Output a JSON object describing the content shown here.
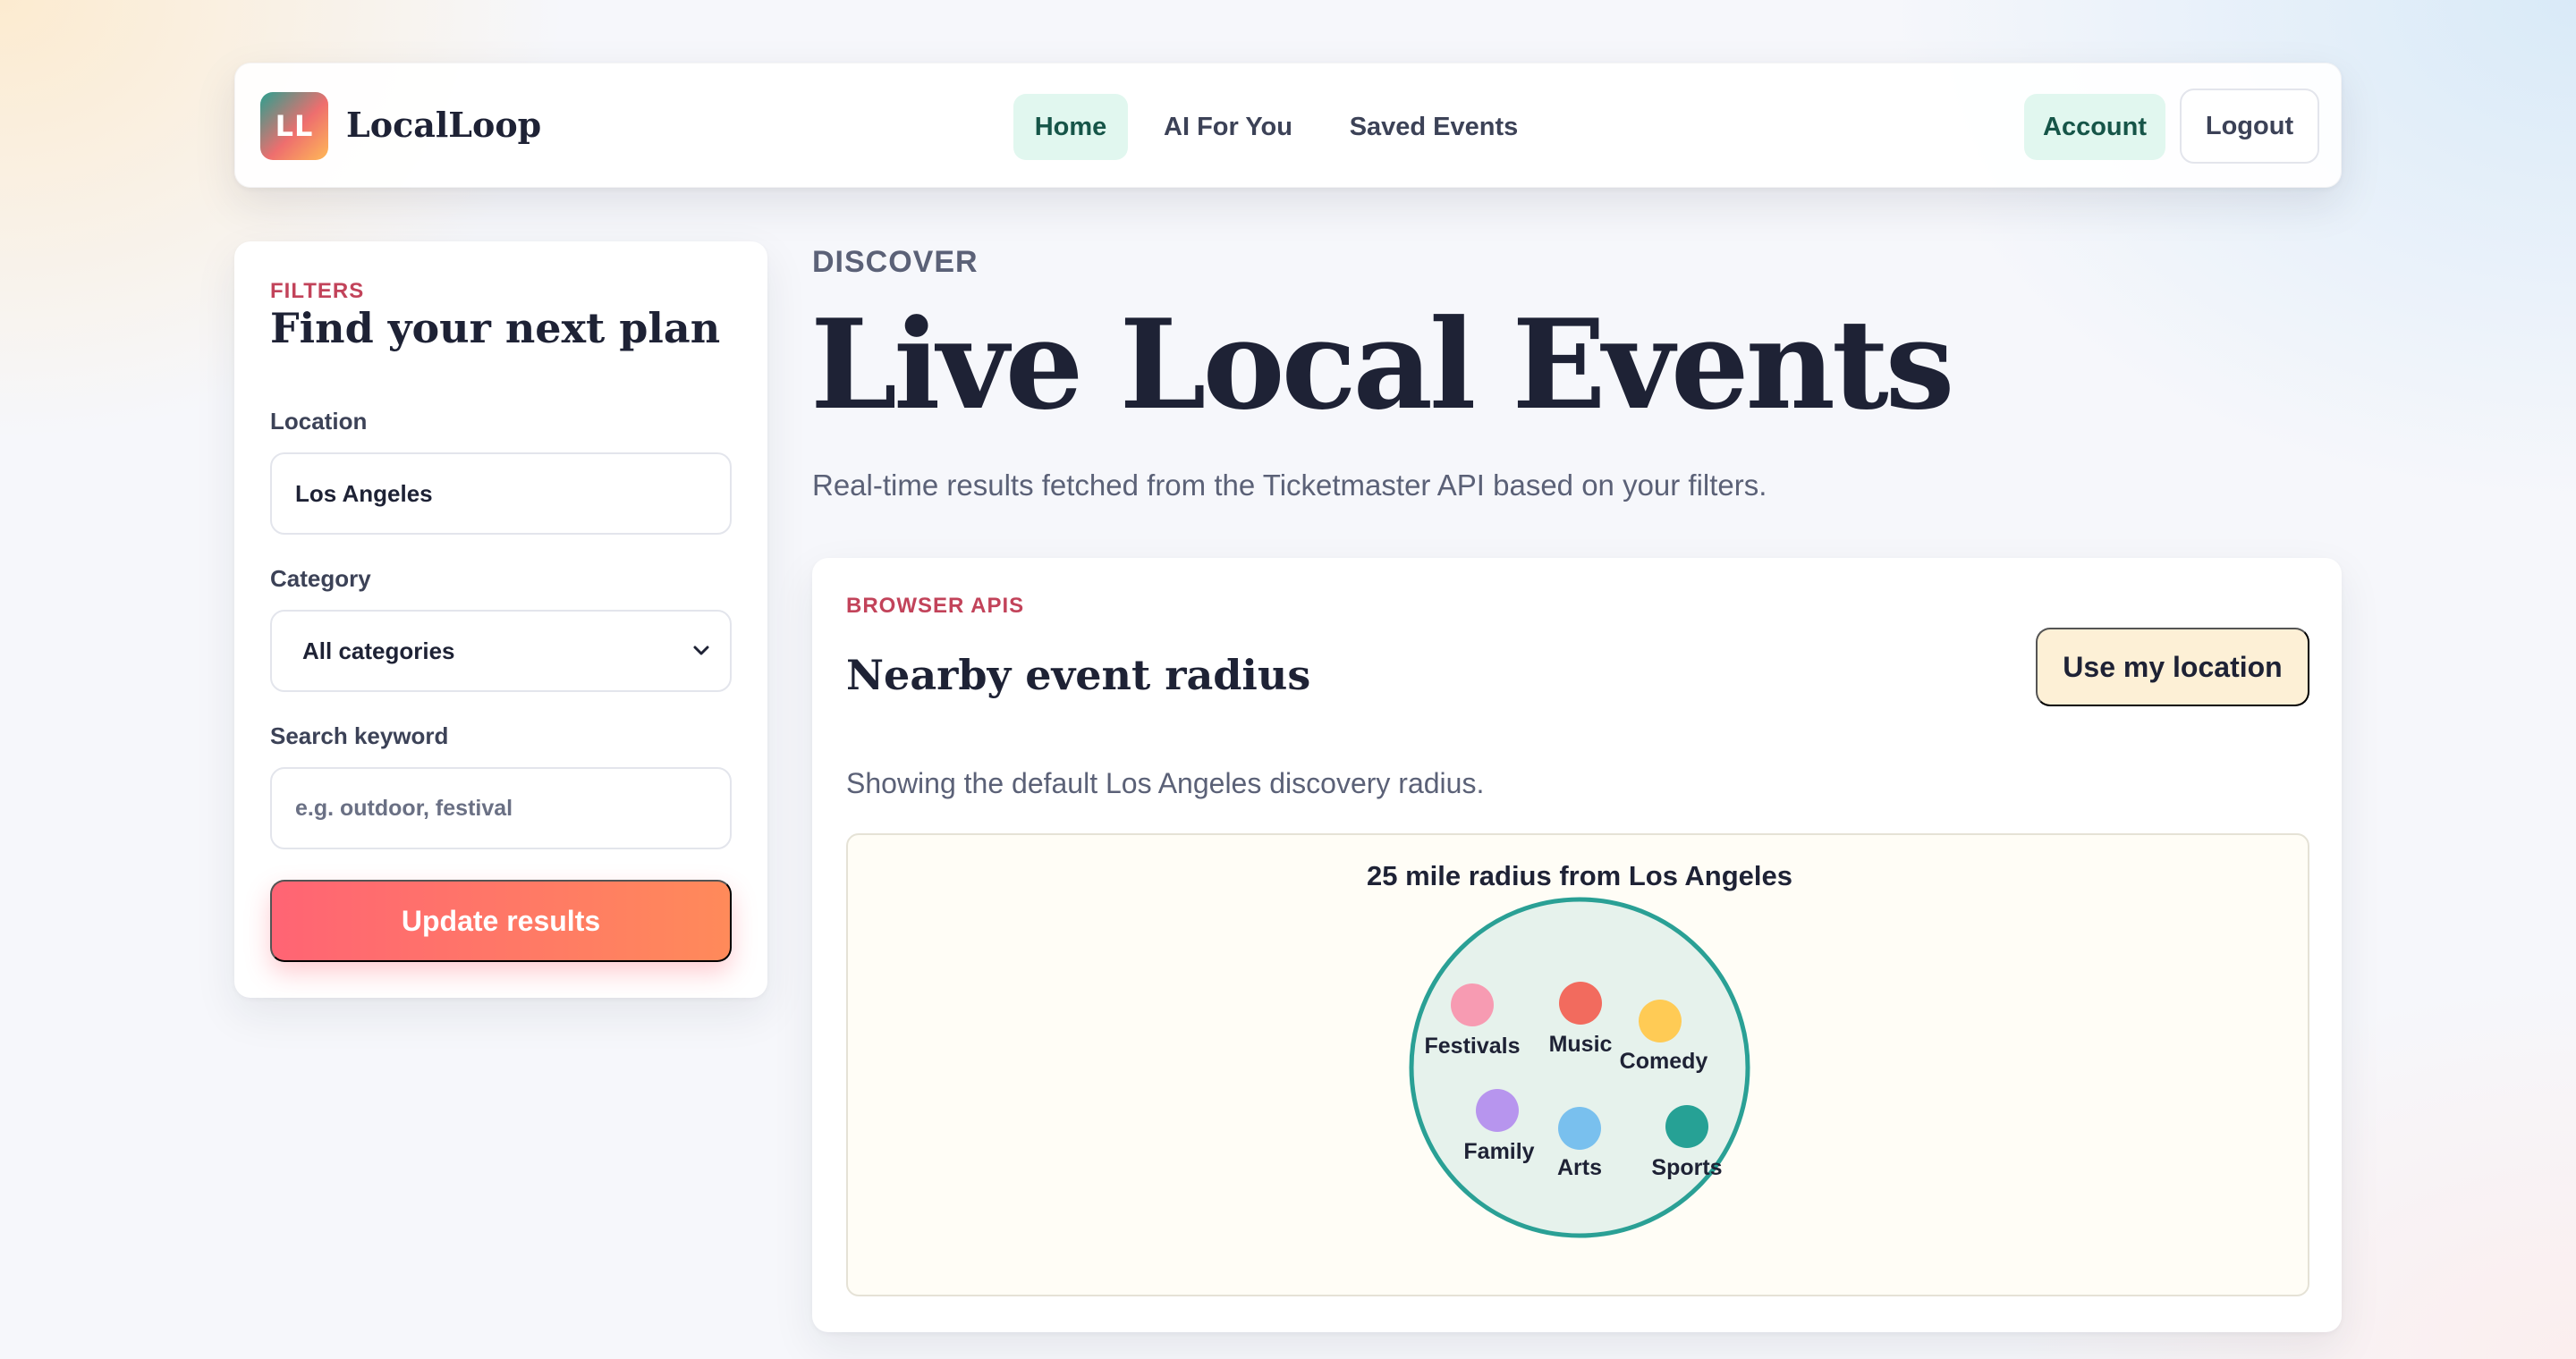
{
  "nav": {
    "logo_initials": "LL",
    "brand": "LocalLoop",
    "links": [
      {
        "label": "Home",
        "active": true
      },
      {
        "label": "AI For You",
        "active": false
      },
      {
        "label": "Saved Events",
        "active": false
      }
    ],
    "account_label": "Account",
    "logout_label": "Logout"
  },
  "filters": {
    "eyebrow": "FILTERS",
    "title": "Find your next plan",
    "location_label": "Location",
    "location_value": "Los Angeles",
    "category_label": "Category",
    "category_value": "All categories",
    "keyword_label": "Search keyword",
    "keyword_placeholder": "e.g. outdoor, festival",
    "submit_label": "Update results"
  },
  "main": {
    "eyebrow": "DISCOVER",
    "title": "Live Local Events",
    "subtitle": "Real-time results fetched from the Ticketmaster API based on your filters."
  },
  "radius": {
    "eyebrow": "BROWSER APIS",
    "title": "Nearby event radius",
    "button_label": "Use my location",
    "status": "Showing the default Los Angeles discovery radius.",
    "viz_title": "25 mile radius from Los Angeles",
    "categories": [
      {
        "name": "Festivals",
        "color": "#f79bb2"
      },
      {
        "name": "Music",
        "color": "#f26b5e"
      },
      {
        "name": "Comedy",
        "color": "#ffcb55"
      },
      {
        "name": "Family",
        "color": "#b795ee"
      },
      {
        "name": "Arts",
        "color": "#79c0ee"
      },
      {
        "name": "Sports",
        "color": "#26a195"
      }
    ]
  },
  "colors": {
    "accent_coral": "#ff6474",
    "accent_green": "#e1f7ef",
    "circle_stroke": "#2aa095",
    "circle_fill": "#e6f2ec"
  }
}
